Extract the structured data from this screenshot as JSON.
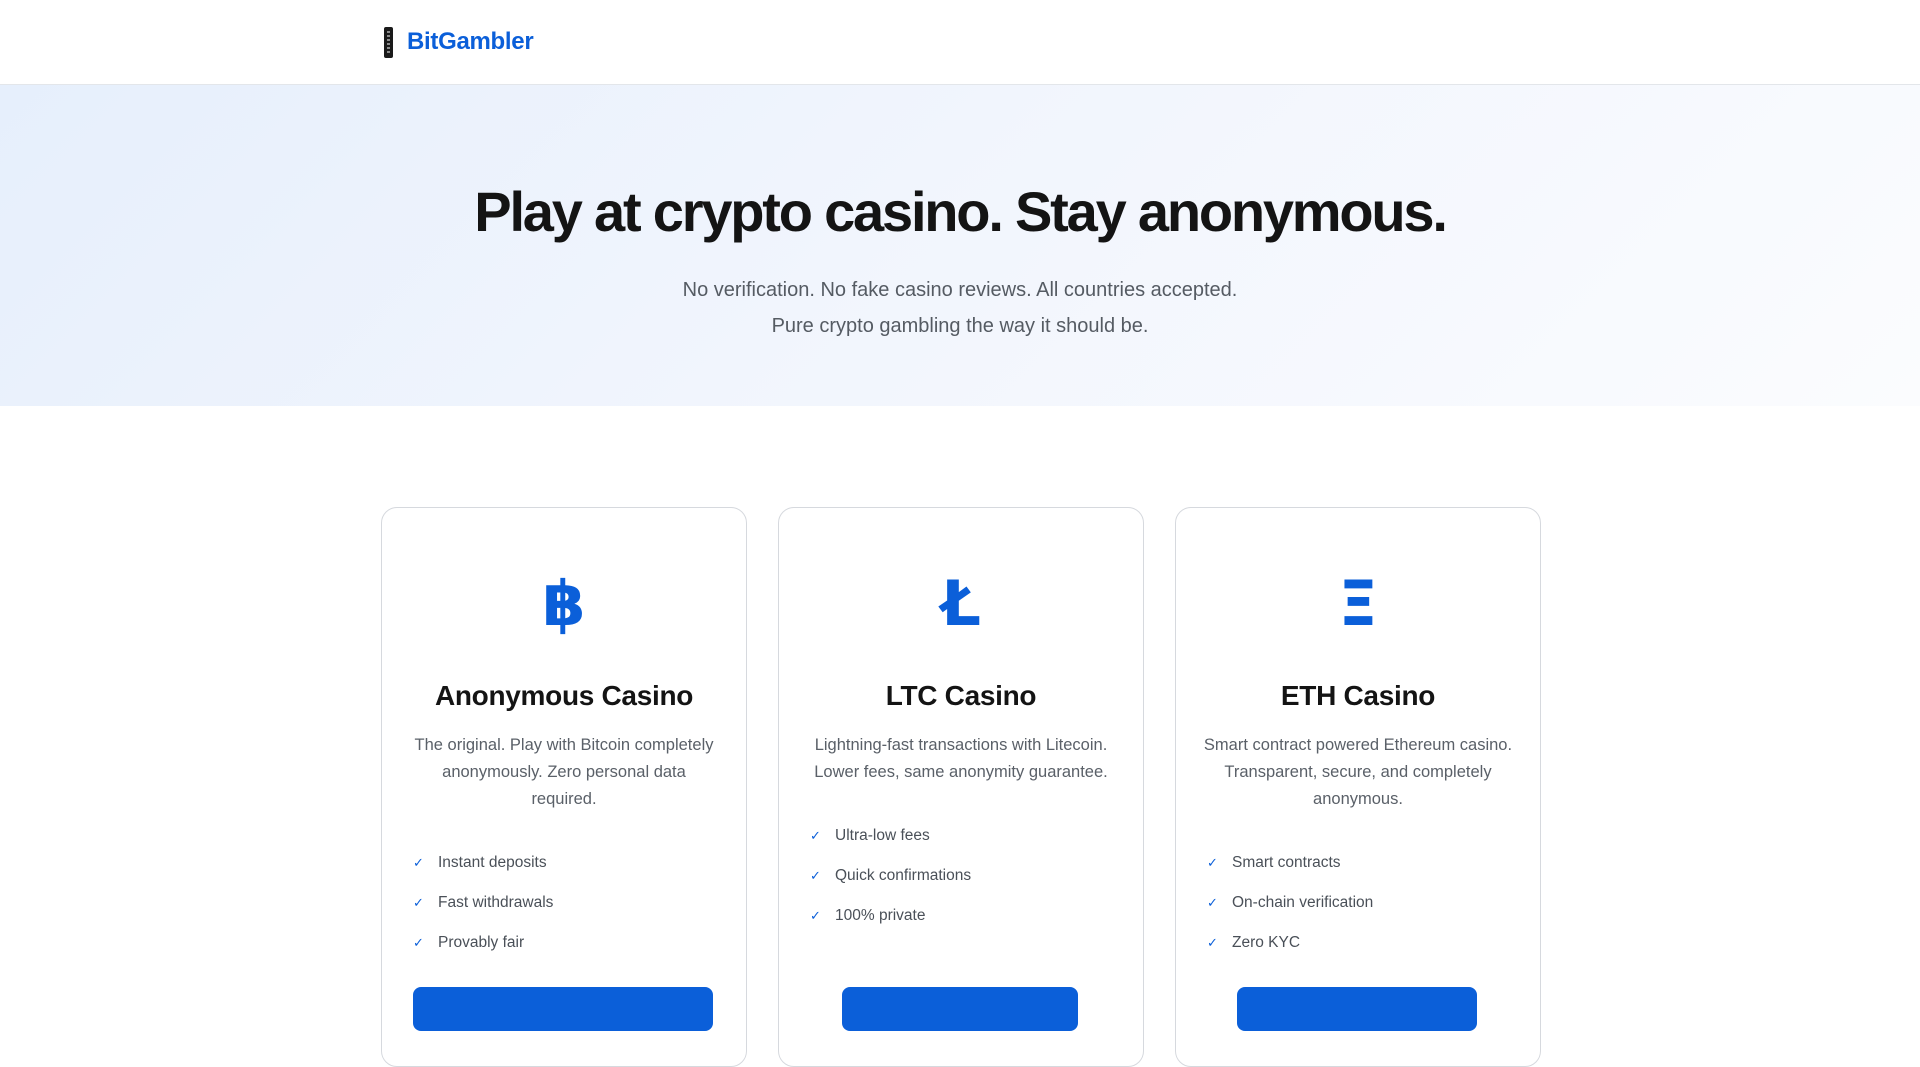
{
  "header": {
    "brand": "BitGambler"
  },
  "hero": {
    "title": "Play at crypto casino. Stay anonymous.",
    "subtitle_line1": "No verification. No fake casino reviews. All countries accepted.",
    "subtitle_line2": "Pure crypto gambling the way it should be."
  },
  "cards": [
    {
      "icon": "bitcoin-icon",
      "glyph": "฿",
      "title": "Anonymous Casino",
      "description": "The original. Play with Bitcoin completely anonymously. Zero personal data required.",
      "features": [
        "Instant deposits",
        "Fast withdrawals",
        "Provably fair"
      ],
      "cta": ""
    },
    {
      "icon": "litecoin-icon",
      "glyph": "Ł",
      "title": "LTC Casino",
      "description": "Lightning-fast transactions with Litecoin. Lower fees, same anonymity guarantee.",
      "features": [
        "Ultra-low fees",
        "Quick confirmations",
        "100% private"
      ],
      "cta": ""
    },
    {
      "icon": "ethereum-icon",
      "glyph": "Ξ",
      "title": "ETH Casino",
      "description": "Smart contract powered Ethereum casino. Transparent, secure, and completely anonymous.",
      "features": [
        "Smart contracts",
        "On-chain verification",
        "Zero KYC"
      ],
      "cta": ""
    }
  ],
  "icons": {
    "check": "✓"
  },
  "colors": {
    "accent": "#0b5fd9",
    "heading": "#141414",
    "muted": "#5a6068",
    "card_border": "#d6d9de"
  }
}
